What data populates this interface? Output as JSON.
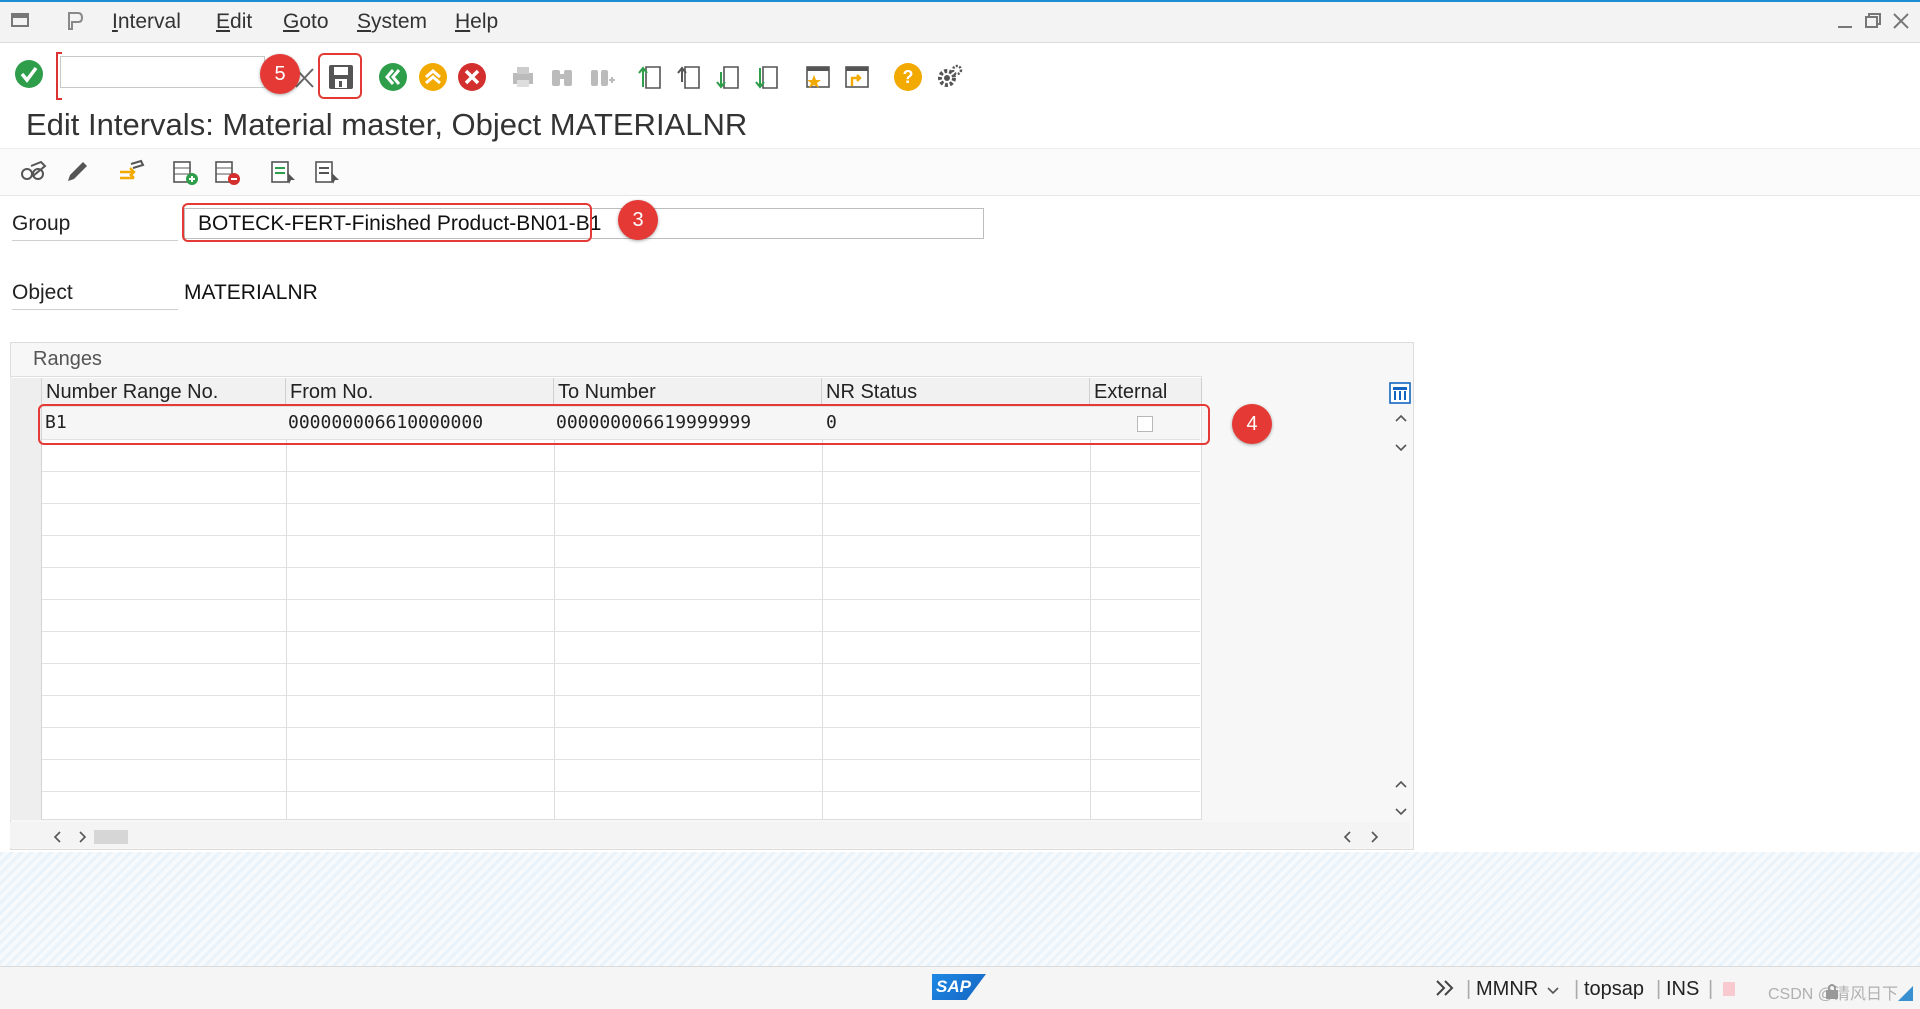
{
  "menu": {
    "items": [
      {
        "label": "Interval",
        "ul": "I",
        "rest": "nterval"
      },
      {
        "label": "Edit",
        "ul": "E",
        "rest": "dit"
      },
      {
        "label": "Goto",
        "ul": "G",
        "rest": "oto"
      },
      {
        "label": "System",
        "ul": "S",
        "rest": "ystem"
      },
      {
        "label": "Help",
        "ul": "H",
        "rest": "elp"
      }
    ]
  },
  "toolbar": {
    "command_field_value": "",
    "icons": [
      "enter-icon",
      "save-icon",
      "back-icon",
      "exit-icon",
      "cancel-icon",
      "print-icon",
      "find-icon",
      "find-next-icon",
      "first-page-icon",
      "previous-page-icon",
      "next-page-icon",
      "last-page-icon",
      "create-session-icon",
      "shortcut-icon",
      "help-icon",
      "settings-icon"
    ]
  },
  "page": {
    "title": "Edit Intervals: Material master, Object MATERIALNR"
  },
  "form": {
    "group_label": "Group",
    "group_value": "BOTECK-FERT-Finished Product-BN01-B1",
    "object_label": "Object",
    "object_value": "MATERIALNR"
  },
  "ranges": {
    "title": "Ranges",
    "columns": [
      "Number Range No.",
      "From No.",
      "To Number",
      "NR Status",
      "External"
    ],
    "rows": [
      {
        "nr": "B1",
        "from": "000000006610000000",
        "to": "000000006619999999",
        "status": "0",
        "external": false
      }
    ]
  },
  "annotations": {
    "badge_3": "3",
    "badge_4": "4",
    "badge_5": "5"
  },
  "status": {
    "logo": "SAP",
    "transaction": "MMNR",
    "system": "topsap",
    "mode": "INS",
    "watermark": "CSDN @清风日下"
  }
}
